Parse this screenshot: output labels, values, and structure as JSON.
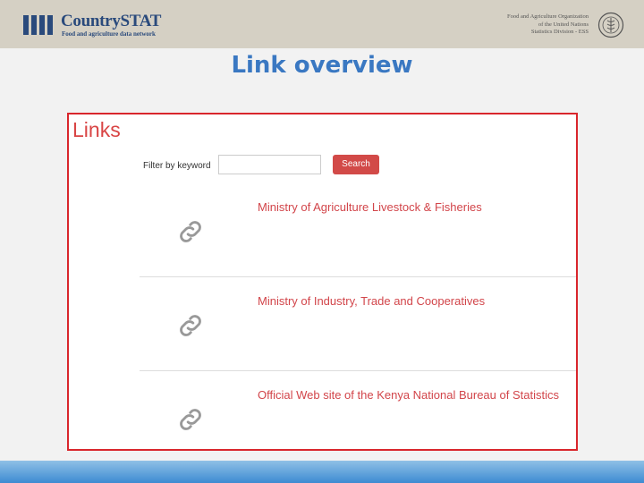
{
  "header": {
    "logo_title": "CountrySTAT",
    "logo_subtitle": "Food and agriculture data network",
    "org_lines": [
      "Food and Agriculture Organization",
      "of the United Nations",
      "Statistics Division - ESS"
    ]
  },
  "slide_title": "Link overview",
  "panel": {
    "heading": "Links",
    "filter_label": "Filter by keyword",
    "filter_value": "",
    "search_label": "Search",
    "links": [
      {
        "label": "Ministry of Agriculture Livestock & Fisheries"
      },
      {
        "label": "Ministry of Industry, Trade and Cooperatives"
      },
      {
        "label": "Official Web site of the Kenya National Bureau of Statistics"
      }
    ]
  },
  "colors": {
    "accent_red": "#d2454a",
    "title_blue": "#3a78c2",
    "header_bg": "#d5d0c4",
    "logo_blue": "#2a4a7c"
  },
  "icons": {
    "link": "link-icon",
    "emblem": "fao-emblem-icon"
  }
}
